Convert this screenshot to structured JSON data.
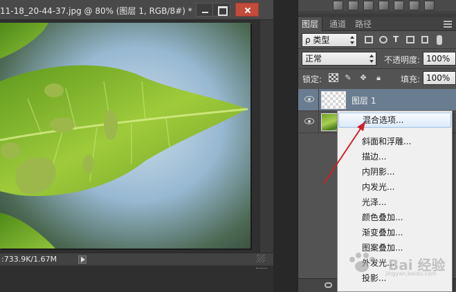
{
  "document": {
    "title": "11-18_20-44-37.jpg @ 80% (图层 1, RGB/8#) *",
    "status_text": ":733.9K/1.67M"
  },
  "panel": {
    "tabs": [
      {
        "label": "图层",
        "active": true
      },
      {
        "label": "通道",
        "active": false
      },
      {
        "label": "路径",
        "active": false
      }
    ],
    "filter_kind": "ρ 类型",
    "blend_mode": "正常",
    "opacity_label": "不透明度:",
    "opacity_value": "100%",
    "lock_label": "锁定:",
    "fill_label": "填充:",
    "fill_value": "100%",
    "layers": [
      {
        "name": "图层 1",
        "selected": true,
        "thumbnail": "transparent"
      },
      {
        "name": "",
        "selected": false,
        "thumbnail": "leaf-photo"
      }
    ]
  },
  "context_menu": {
    "items": [
      {
        "label": "混合选项...",
        "highlighted": true
      },
      {
        "label": "斜面和浮雕...",
        "highlighted": false
      },
      {
        "label": "描边...",
        "highlighted": false
      },
      {
        "label": "内阴影...",
        "highlighted": false
      },
      {
        "label": "内发光...",
        "highlighted": false
      },
      {
        "label": "光泽...",
        "highlighted": false
      },
      {
        "label": "颜色叠加...",
        "highlighted": false
      },
      {
        "label": "渐变叠加...",
        "highlighted": false
      },
      {
        "label": "图案叠加...",
        "highlighted": false
      },
      {
        "label": "外发光...",
        "highlighted": false
      },
      {
        "label": "投影...",
        "highlighted": false
      }
    ]
  },
  "watermark": {
    "text": "Bai 经验",
    "sub": "jingyan.baidu.com"
  },
  "colors": {
    "selected_row": "#6a7c90",
    "annotation_arrow": "#d0202a",
    "menu_highlight": "#dceaf9"
  }
}
